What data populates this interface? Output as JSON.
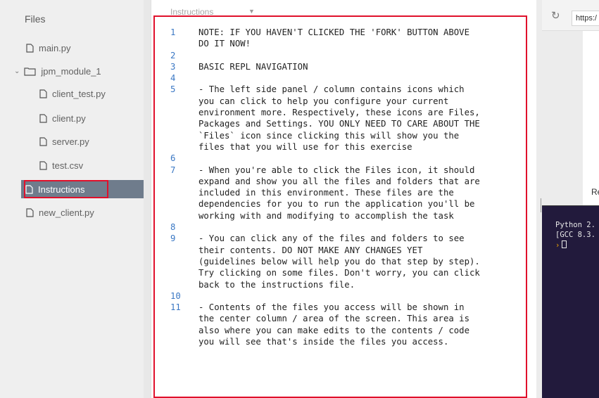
{
  "sidebar": {
    "title": "Files",
    "items": [
      {
        "label": "main.py",
        "type": "file",
        "indent": 0
      },
      {
        "label": "jpm_module_1",
        "type": "folder",
        "indent": 0
      },
      {
        "label": "client_test.py",
        "type": "file",
        "indent": 1
      },
      {
        "label": "client.py",
        "type": "file",
        "indent": 1
      },
      {
        "label": "server.py",
        "type": "file",
        "indent": 1
      },
      {
        "label": "test.csv",
        "type": "file",
        "indent": 1
      },
      {
        "label": "Instructions",
        "type": "file",
        "indent": 1,
        "selected": true
      },
      {
        "label": "new_client.py",
        "type": "file",
        "indent": 0
      }
    ]
  },
  "editor": {
    "tab_label": "Instructions",
    "rows": [
      {
        "ln": "1",
        "text": "NOTE: IF YOU HAVEN'T CLICKED THE 'FORK' BUTTON ABOVE"
      },
      {
        "ln": "",
        "text": "DO IT NOW!"
      },
      {
        "ln": "2",
        "text": ""
      },
      {
        "ln": "3",
        "text": "BASIC REPL NAVIGATION"
      },
      {
        "ln": "4",
        "text": ""
      },
      {
        "ln": "5",
        "text": "- The left side panel / column contains icons which"
      },
      {
        "ln": "",
        "text": "you can click to help you configure your current"
      },
      {
        "ln": "",
        "text": "environment more. Respectively, these icons are Files,"
      },
      {
        "ln": "",
        "text": "Packages and Settings. YOU ONLY NEED TO CARE ABOUT THE"
      },
      {
        "ln": "",
        "text": "`Files` icon since clicking this will show you the"
      },
      {
        "ln": "",
        "text": "files that you will use for this exercise"
      },
      {
        "ln": "6",
        "text": ""
      },
      {
        "ln": "7",
        "text": "- When you're able to click the Files icon, it should"
      },
      {
        "ln": "",
        "text": "expand and show you all the files and folders that are"
      },
      {
        "ln": "",
        "text": "included in this environment. These files are the"
      },
      {
        "ln": "",
        "text": "dependencies for you to run the application you'll be"
      },
      {
        "ln": "",
        "text": "working with and modifying to accomplish the task"
      },
      {
        "ln": "8",
        "text": ""
      },
      {
        "ln": "9",
        "text": "- You can click any of the files and folders to see"
      },
      {
        "ln": "",
        "text": "their contents. DO NOT MAKE ANY CHANGES YET"
      },
      {
        "ln": "",
        "text": "(guidelines below will help you do that step by step)."
      },
      {
        "ln": "",
        "text": "Try clicking on some files. Don't worry, you can click"
      },
      {
        "ln": "",
        "text": "back to the instructions file."
      },
      {
        "ln": "10",
        "text": ""
      },
      {
        "ln": "11",
        "text": "- Contents of the files you access will be shown in"
      },
      {
        "ln": "",
        "text": "the center column / area of the screen. This area is"
      },
      {
        "ln": "",
        "text": "also where you can make edits to the contents / code"
      },
      {
        "ln": "",
        "text": "you will see that's inside the files you access."
      }
    ]
  },
  "browser": {
    "url": "https:/",
    "preview_text": "Re"
  },
  "console": {
    "lines": [
      "Python 2.",
      "[GCC 8.3."
    ],
    "prompt": "›"
  },
  "colors": {
    "highlight_red": "#e0102b",
    "selected_bg": "#6f7c8c",
    "line_number": "#3b78c4",
    "console_bg": "#221a3c"
  }
}
